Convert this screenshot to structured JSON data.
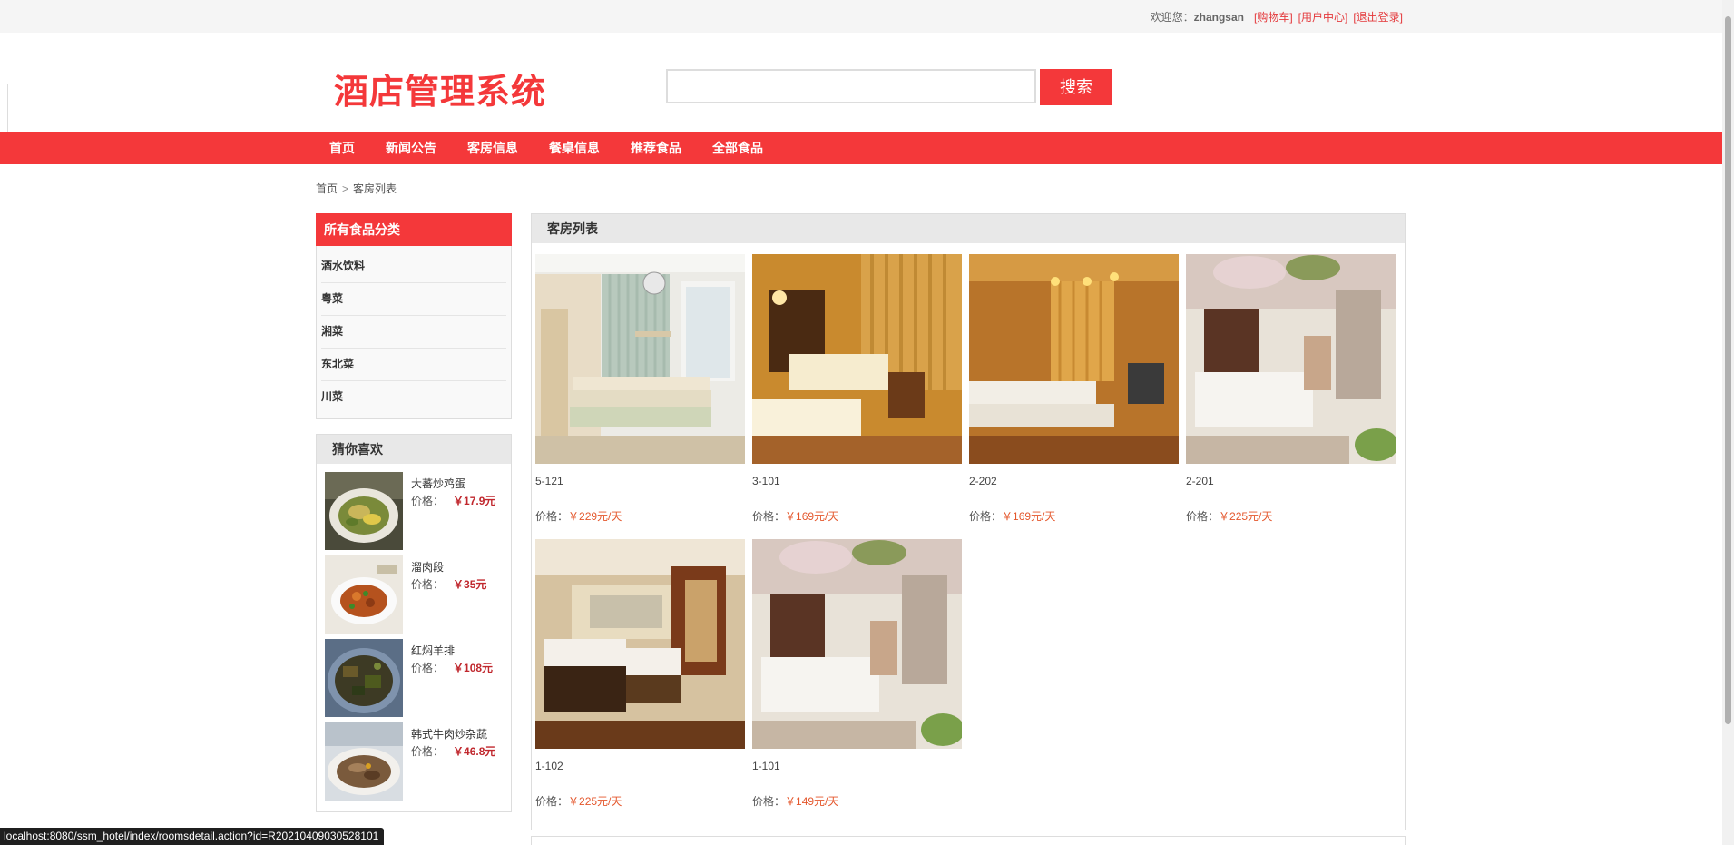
{
  "topbar": {
    "welcome": "欢迎您：",
    "username": "zhangsan",
    "links": [
      "[购物车]",
      "[用户中心]",
      "[退出登录]"
    ]
  },
  "header": {
    "logo": "酒店管理系统",
    "search_value": "",
    "search_button": "搜索"
  },
  "nav": {
    "items": [
      "首页",
      "新闻公告",
      "客房信息",
      "餐桌信息",
      "推荐食品",
      "全部食品"
    ]
  },
  "breadcrumb": {
    "home": "首页",
    "sep": ">",
    "current": "客房列表"
  },
  "categories": {
    "title": "所有食品分类",
    "items": [
      "酒水饮料",
      "粤菜",
      "湘菜",
      "东北菜",
      "川菜"
    ]
  },
  "guess": {
    "title": "猜你喜欢",
    "price_label": "价格：",
    "items": [
      {
        "name": "大蕃炒鸡蛋",
        "price": "￥17.9元"
      },
      {
        "name": "溜肉段",
        "price": "￥35元"
      },
      {
        "name": "红焖羊排",
        "price": "￥108元"
      },
      {
        "name": "韩式牛肉炒杂蔬",
        "price": "￥46.8元"
      }
    ]
  },
  "rooms": {
    "title": "客房列表",
    "price_label": "价格：",
    "items": [
      {
        "name": "5-121",
        "price": "￥229元/天"
      },
      {
        "name": "3-101",
        "price": "￥169元/天"
      },
      {
        "name": "2-202",
        "price": "￥169元/天"
      },
      {
        "name": "2-201",
        "price": "￥225元/天"
      },
      {
        "name": "1-102",
        "price": "￥225元/天"
      },
      {
        "name": "1-101",
        "price": "￥149元/天"
      }
    ]
  },
  "status": {
    "url": "localhost:8080/ssm_hotel/index/roomsdetail.action?id=R20210409030528101"
  },
  "colors": {
    "brand": "#f4383a",
    "price": "#e4562b",
    "food_price": "#c0272d"
  }
}
